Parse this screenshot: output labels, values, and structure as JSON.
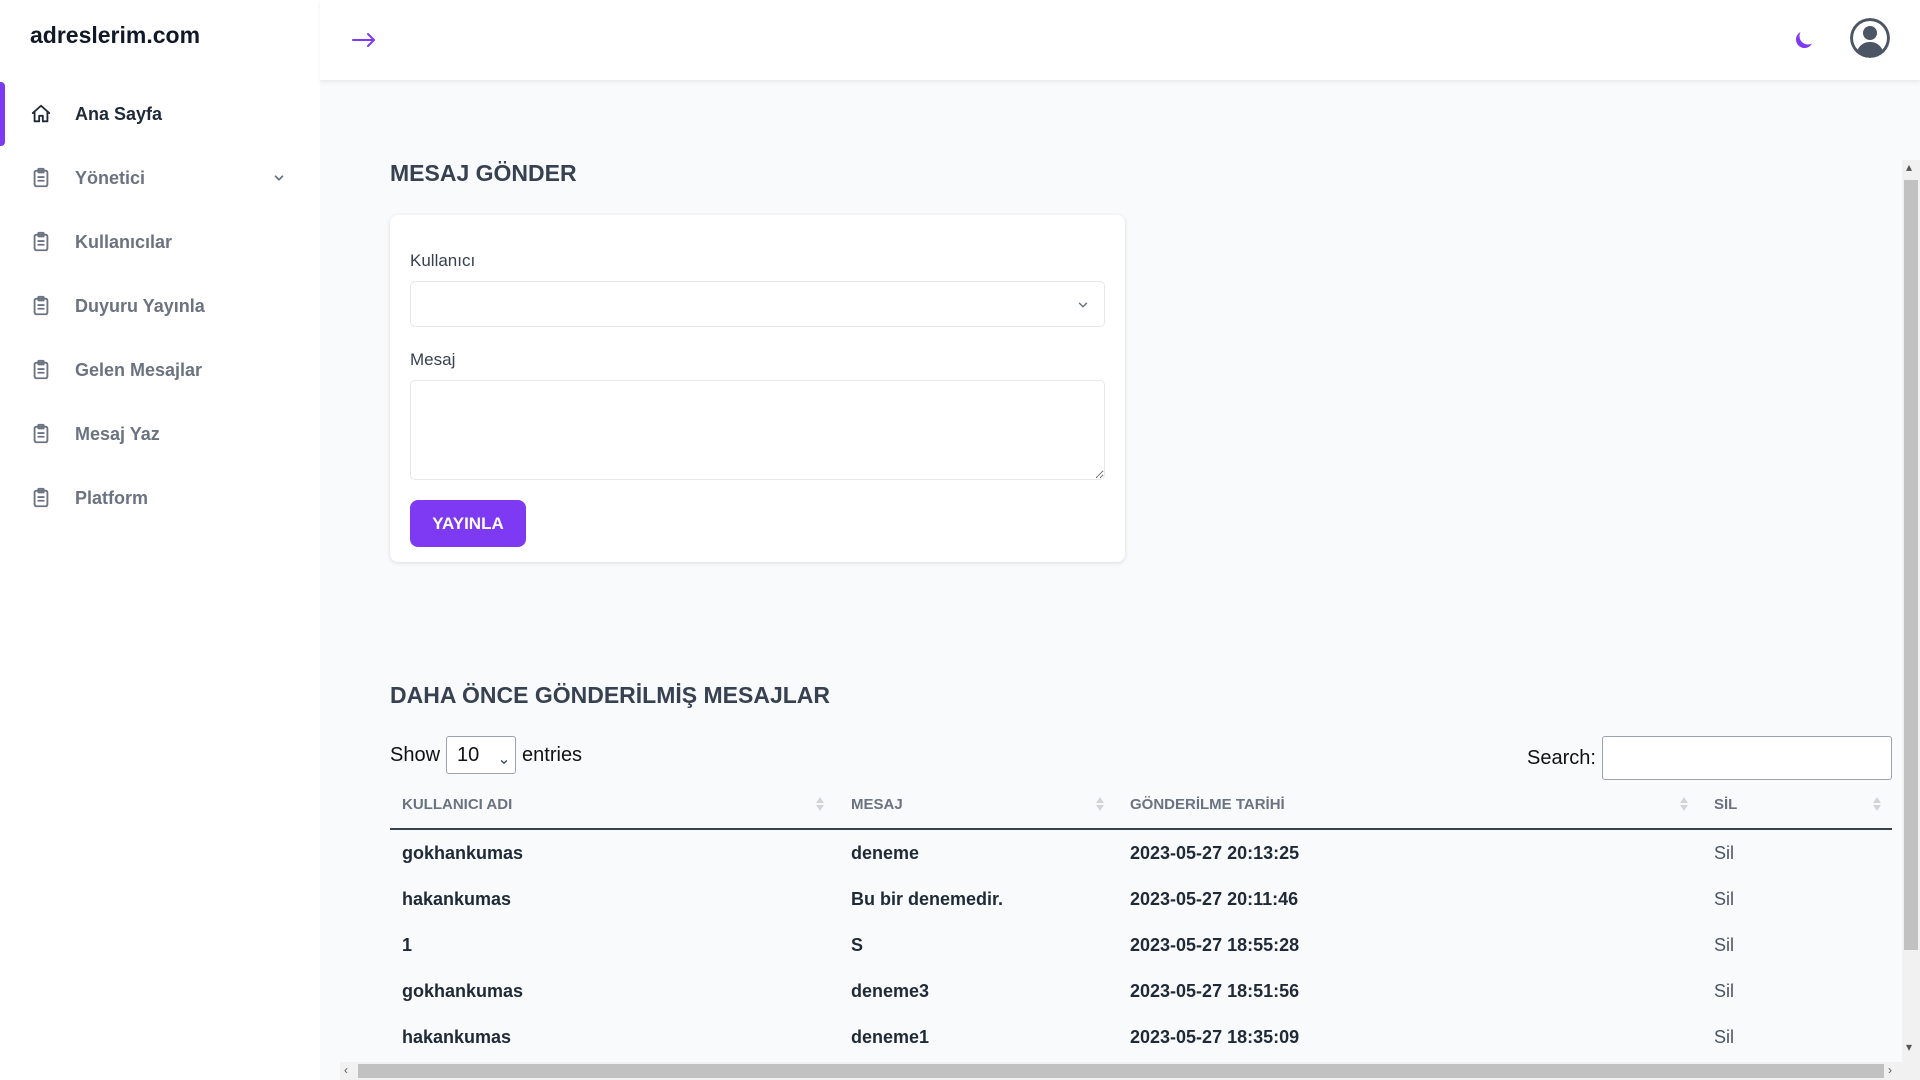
{
  "brand": "adreslerim.com",
  "colors": {
    "accent": "#7e3af2",
    "sidebar_bg": "#ffffff",
    "page_bg": "#f9fafb"
  },
  "sidebar": {
    "items": [
      {
        "label": "Ana Sayfa",
        "icon": "home-icon",
        "active": true
      },
      {
        "label": "Yönetici",
        "icon": "clipboard-icon",
        "has_submenu": true
      },
      {
        "label": "Kullanıcılar",
        "icon": "clipboard-icon"
      },
      {
        "label": "Duyuru Yayınla",
        "icon": "clipboard-icon"
      },
      {
        "label": "Gelen Mesajlar",
        "icon": "clipboard-icon"
      },
      {
        "label": "Mesaj Yaz",
        "icon": "clipboard-icon"
      },
      {
        "label": "Platform",
        "icon": "clipboard-icon"
      }
    ]
  },
  "header": {
    "toggle_icon": "arrow-right-icon",
    "theme_icon": "moon-icon",
    "avatar_icon": "user-avatar-icon"
  },
  "form": {
    "title": "MESAJ GÖNDER",
    "user_label": "Kullanıcı",
    "user_value": "",
    "message_label": "Mesaj",
    "message_value": "",
    "submit_label": "YAYINLA"
  },
  "messages": {
    "title": "DAHA ÖNCE GÖNDERİLMİŞ MESAJLAR",
    "show_label": "Show",
    "entries_value": "10",
    "entries_label": "entries",
    "search_label": "Search:",
    "search_value": "",
    "columns": [
      "KULLANICI ADI",
      "MESAJ",
      "GÖNDERİLME TARİHİ",
      "SİL"
    ],
    "rows": [
      {
        "user": "gokhankumas",
        "message": "deneme",
        "date": "2023-05-27 20:13:25",
        "action": "Sil"
      },
      {
        "user": "hakankumas",
        "message": "Bu bir denemedir.",
        "date": "2023-05-27 20:11:46",
        "action": "Sil"
      },
      {
        "user": "1",
        "message": "S",
        "date": "2023-05-27 18:55:28",
        "action": "Sil"
      },
      {
        "user": "gokhankumas",
        "message": "deneme3",
        "date": "2023-05-27 18:51:56",
        "action": "Sil"
      },
      {
        "user": "hakankumas",
        "message": "deneme1",
        "date": "2023-05-27 18:35:09",
        "action": "Sil"
      }
    ]
  }
}
